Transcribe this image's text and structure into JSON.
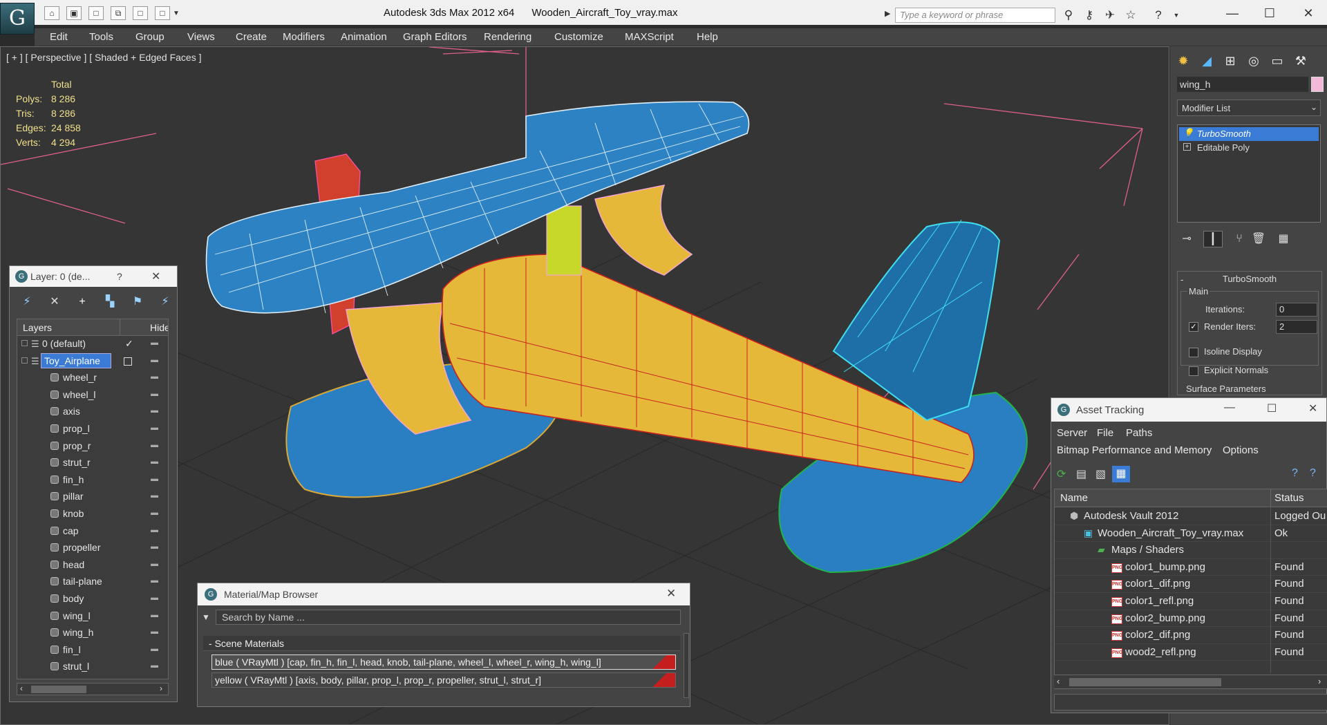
{
  "window": {
    "app_title": "Autodesk 3ds Max  2012 x64",
    "file_title": "Wooden_Aircraft_Toy_vray.max",
    "search_placeholder": "Type a keyword or phrase",
    "logo_glyph": "G"
  },
  "menu": [
    "Edit",
    "Tools",
    "Group",
    "Views",
    "Create",
    "Modifiers",
    "Animation",
    "Graph Editors",
    "Rendering",
    "Customize",
    "MAXScript",
    "Help"
  ],
  "viewport": {
    "label": "[ + ] [ Perspective ] [ Shaded + Edged Faces ]",
    "stats": {
      "header": "Total",
      "rows": [
        {
          "label": "Polys:",
          "value": "8 286"
        },
        {
          "label": "Tris:",
          "value": "8 286"
        },
        {
          "label": "Edges:",
          "value": "24 858"
        },
        {
          "label": "Verts:",
          "value": "4 294"
        }
      ]
    }
  },
  "command_panel": {
    "object_name": "wing_h",
    "object_color": "#f2b8d8",
    "modifier_list_label": "Modifier List",
    "stack": [
      "TurboSmooth",
      "Editable Poly"
    ],
    "turbosmooth": {
      "title": "TurboSmooth",
      "main_label": "Main",
      "iterations_label": "Iterations:",
      "iterations_value": "0",
      "render_iters_label": "Render Iters:",
      "render_iters_value": "2",
      "render_iters_checked": true,
      "isoline_label": "Isoline Display",
      "explicit_normals_label": "Explicit Normals",
      "surface_params_label": "Surface Parameters"
    }
  },
  "layer_panel": {
    "title": "Layer: 0 (de...",
    "help": "?",
    "columns": {
      "name": "Layers",
      "hide": "Hide"
    },
    "rows": [
      {
        "name": "0 (default)",
        "type": "layer"
      },
      {
        "name": "Toy_Airplane",
        "type": "layer-selected"
      },
      {
        "name": "wheel_r",
        "type": "object"
      },
      {
        "name": "wheel_l",
        "type": "object"
      },
      {
        "name": "axis",
        "type": "object"
      },
      {
        "name": "prop_l",
        "type": "object"
      },
      {
        "name": "prop_r",
        "type": "object"
      },
      {
        "name": "strut_r",
        "type": "object"
      },
      {
        "name": "fin_h",
        "type": "object"
      },
      {
        "name": "pillar",
        "type": "object"
      },
      {
        "name": "knob",
        "type": "object"
      },
      {
        "name": "cap",
        "type": "object"
      },
      {
        "name": "propeller",
        "type": "object"
      },
      {
        "name": "head",
        "type": "object"
      },
      {
        "name": "tail-plane",
        "type": "object"
      },
      {
        "name": "body",
        "type": "object"
      },
      {
        "name": "wing_l",
        "type": "object"
      },
      {
        "name": "wing_h",
        "type": "object"
      },
      {
        "name": "fin_l",
        "type": "object"
      },
      {
        "name": "strut_l",
        "type": "object"
      }
    ]
  },
  "material_browser": {
    "title": "Material/Map Browser",
    "search_placeholder": "Search by Name ...",
    "section": "Scene Materials",
    "materials": [
      "blue  ( VRayMtl )  [cap, fin_h, fin_l, head, knob, tail-plane, wheel_l, wheel_r, wing_h, wing_l]",
      "yellow  ( VRayMtl )  [axis, body, pillar, prop_l, prop_r, propeller, strut_l, strut_r]"
    ]
  },
  "asset_tracking": {
    "title": "Asset Tracking",
    "menu": [
      "Server",
      "File",
      "Paths"
    ],
    "menu2": [
      "Bitmap Performance and Memory",
      "Options"
    ],
    "columns": {
      "name": "Name",
      "status": "Status"
    },
    "rows": [
      {
        "name": "Autodesk Vault 2012",
        "status": "Logged Ou",
        "indent": 0,
        "icon": "vault"
      },
      {
        "name": "Wooden_Aircraft_Toy_vray.max",
        "status": "Ok",
        "indent": 1,
        "icon": "max"
      },
      {
        "name": "Maps / Shaders",
        "status": "",
        "indent": 2,
        "icon": "maps"
      },
      {
        "name": "color1_bump.png",
        "status": "Found",
        "indent": 3,
        "icon": "png"
      },
      {
        "name": "color1_dif.png",
        "status": "Found",
        "indent": 3,
        "icon": "png"
      },
      {
        "name": "color1_refl.png",
        "status": "Found",
        "indent": 3,
        "icon": "png"
      },
      {
        "name": "color2_bump.png",
        "status": "Found",
        "indent": 3,
        "icon": "png"
      },
      {
        "name": "color2_dif.png",
        "status": "Found",
        "indent": 3,
        "icon": "png"
      },
      {
        "name": "wood2_refl.png",
        "status": "Found",
        "indent": 3,
        "icon": "png"
      }
    ]
  },
  "colors": {
    "selection_blue": "#3a7bd5",
    "material_blue": "#2d82c4",
    "material_yellow": "#e6b83a",
    "stats_text": "#f0e08a"
  }
}
